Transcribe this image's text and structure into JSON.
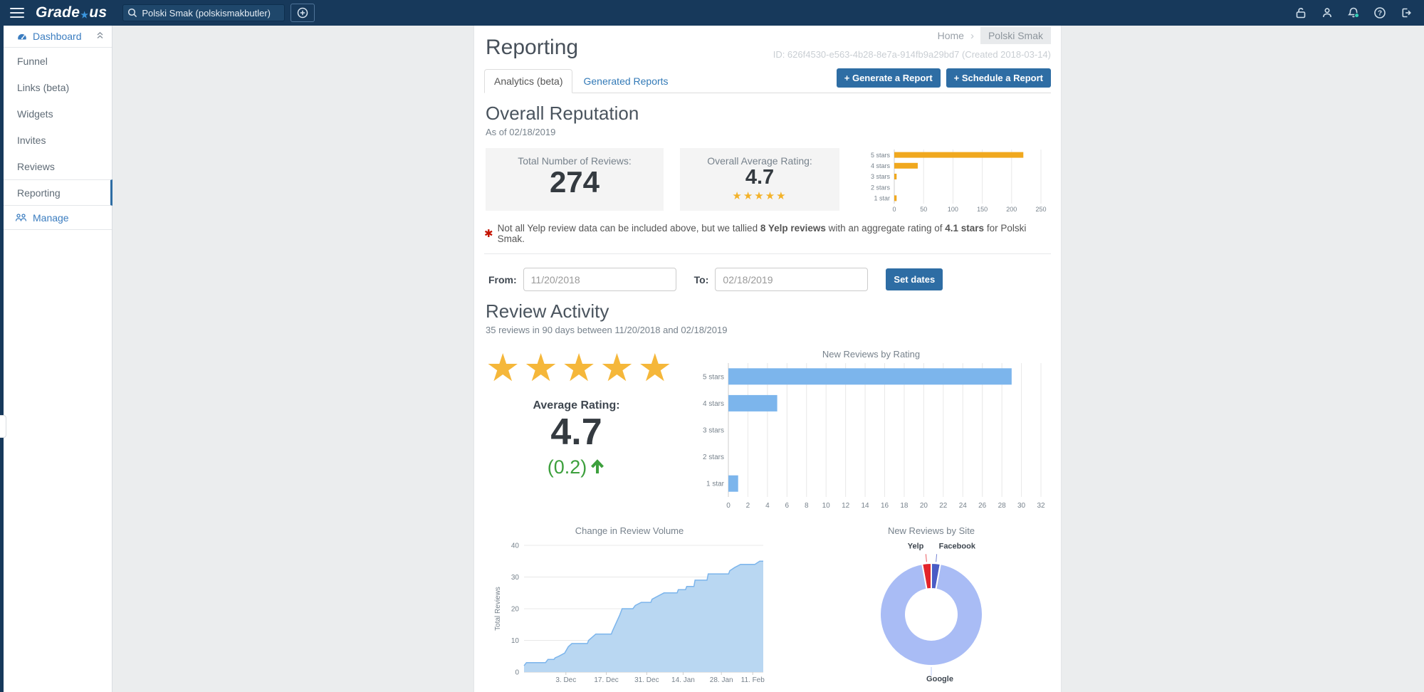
{
  "topbar": {
    "brand_1": "Grade",
    "brand_2": "us",
    "search_value": "Polski Smak (polskismakbutler)"
  },
  "sidebar": {
    "dashboard_label": "Dashboard",
    "items": [
      {
        "label": "Funnel"
      },
      {
        "label": "Links (beta)"
      },
      {
        "label": "Widgets"
      },
      {
        "label": "Invites"
      },
      {
        "label": "Reviews"
      },
      {
        "label": "Reporting",
        "active": true
      }
    ],
    "manage_label": "Manage"
  },
  "header": {
    "title": "Reporting",
    "breadcrumb_home": "Home",
    "breadcrumb_sep": "›",
    "breadcrumb_current": "Polski Smak",
    "id_line": "ID: 626f4530-e563-4b28-8e7a-914fb9a29bd7 (Created 2018-03-14)"
  },
  "tabs": {
    "active": "Analytics (beta)",
    "inactive": "Generated Reports"
  },
  "actions": {
    "generate": "+ Generate a Report",
    "schedule": "+ Schedule a Report"
  },
  "overall": {
    "heading": "Overall Reputation",
    "as_of": "As of 02/18/2019",
    "total_label": "Total Number of Reviews:",
    "total_value": "274",
    "avg_label": "Overall Average Rating:",
    "avg_value": "4.7",
    "stars": "★★★★★"
  },
  "yelp_note": {
    "pre": "Not all Yelp review data can be included above, but we tallied ",
    "bold1": "8 Yelp reviews",
    "mid": " with an aggregate rating of ",
    "bold2": "4.1 stars",
    "post": " for Polski Smak."
  },
  "date_filter": {
    "from_label": "From:",
    "from_value": "11/20/2018",
    "to_label": "To:",
    "to_value": "02/18/2019",
    "submit": "Set dates"
  },
  "activity": {
    "heading": "Review Activity",
    "subtitle": "35 reviews in 90 days between 11/20/2018 and 02/18/2019",
    "stars": "★★★★★",
    "avg_label": "Average Rating:",
    "avg_value": "4.7",
    "change": "(0.2)"
  },
  "colors": {
    "topbar": "#17395b",
    "accent_button": "#2e6da4",
    "link_blue": "#337ab7",
    "gold": "#f3b229",
    "bar_blue": "#7cb5ec",
    "green_positive": "#3da03d"
  },
  "chart_data": [
    {
      "id": "reputation_distribution",
      "type": "bar",
      "orientation": "horizontal",
      "categories": [
        "5 stars",
        "4 stars",
        "3 stars",
        "2 stars",
        "1 star"
      ],
      "values": [
        220,
        40,
        4,
        0,
        4
      ],
      "xmax": 250,
      "tick_step": 50,
      "color": "#f0a81e",
      "grid": true
    },
    {
      "id": "new_reviews_by_rating",
      "type": "bar",
      "orientation": "horizontal",
      "title": "New Reviews by Rating",
      "categories": [
        "5 stars",
        "4 stars",
        "3 stars",
        "2 stars",
        "1 star"
      ],
      "values": [
        29,
        5,
        0,
        0,
        1
      ],
      "xmax": 32,
      "tick_step": 2,
      "color": "#7cb5ec",
      "grid": true
    },
    {
      "id": "change_in_review_volume",
      "type": "area",
      "title": "Change in Review Volume",
      "ylabel": "Total Reviews",
      "ymax": 40,
      "yticks": [
        0,
        10,
        20,
        30,
        40
      ],
      "xticks": [
        {
          "label": "3. Dec",
          "pos": 0.175
        },
        {
          "label": "17. Dec",
          "pos": 0.344
        },
        {
          "label": "31. Dec",
          "pos": 0.513
        },
        {
          "label": "14. Jan",
          "pos": 0.665
        },
        {
          "label": "28. Jan",
          "pos": 0.825
        },
        {
          "label": "11. Feb",
          "pos": 0.956
        }
      ],
      "date_range": [
        "11/20/2018",
        "02/18/2019"
      ],
      "points": [
        [
          0,
          2
        ],
        [
          0.01,
          3
        ],
        [
          0.09,
          3
        ],
        [
          0.1,
          4
        ],
        [
          0.125,
          4
        ],
        [
          0.13,
          4.5
        ],
        [
          0.145,
          5
        ],
        [
          0.17,
          6
        ],
        [
          0.185,
          8
        ],
        [
          0.2,
          9
        ],
        [
          0.265,
          9
        ],
        [
          0.27,
          10
        ],
        [
          0.3,
          12
        ],
        [
          0.365,
          12
        ],
        [
          0.37,
          13
        ],
        [
          0.4,
          18
        ],
        [
          0.41,
          20
        ],
        [
          0.455,
          20
        ],
        [
          0.465,
          21
        ],
        [
          0.49,
          22
        ],
        [
          0.53,
          22
        ],
        [
          0.535,
          23
        ],
        [
          0.56,
          24
        ],
        [
          0.585,
          25
        ],
        [
          0.64,
          25
        ],
        [
          0.645,
          26
        ],
        [
          0.675,
          26
        ],
        [
          0.68,
          27
        ],
        [
          0.71,
          27
        ],
        [
          0.715,
          29
        ],
        [
          0.765,
          29
        ],
        [
          0.77,
          31
        ],
        [
          0.855,
          31
        ],
        [
          0.86,
          32
        ],
        [
          0.88,
          33
        ],
        [
          0.905,
          34
        ],
        [
          0.965,
          34
        ],
        [
          0.985,
          35
        ],
        [
          1,
          35
        ]
      ],
      "fill": "#b9d7f2",
      "stroke": "#7cb5ec",
      "grid": true
    },
    {
      "id": "new_reviews_by_site",
      "type": "pie",
      "title": "New Reviews by Site",
      "donut": true,
      "slices": [
        {
          "label": "Yelp",
          "value": 1,
          "color": "#e3242b"
        },
        {
          "label": "Facebook",
          "value": 1,
          "color": "#4a5cc5"
        },
        {
          "label": "Google",
          "value": 33,
          "color": "#a9bcf5"
        }
      ]
    }
  ]
}
